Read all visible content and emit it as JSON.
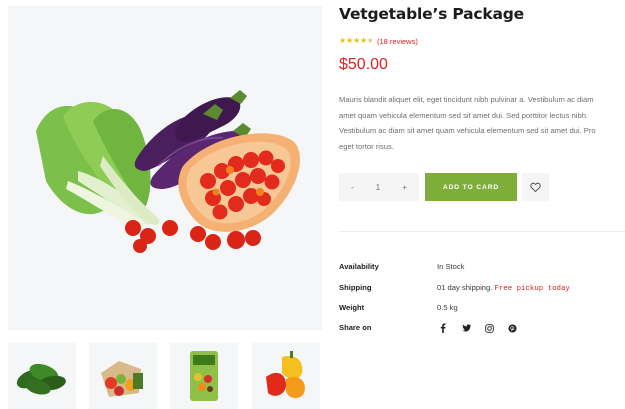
{
  "product": {
    "title": "Vetgetable’s Package",
    "rating": 4.5,
    "reviews": "(18 reviews)",
    "price": "$50.00",
    "description_lines": [
      "Mauris blandit aliquet elit, eget tincidunt nibh pulvinar a. Vestibulum ac diam",
      "amet quam vehicula elementum sed sit amet dui. Sed porttitor lectus nibh.",
      "Vestibulum ac diam sit amet quam vehicula elementum sed sit amet dui. Pro",
      "eget tortor risus."
    ]
  },
  "purchase": {
    "minus": "-",
    "quantity": "1",
    "plus": "+",
    "add_to_cart": "ADD TO CARD"
  },
  "meta": {
    "availability_label": "Availability",
    "availability_value": "In Stock",
    "shipping_label": "Shipping",
    "shipping_value": "01 day shipping.",
    "shipping_note": "Free pickup today",
    "weight_label": "Weight",
    "weight_value": "0.5 kg",
    "share_label": "Share on"
  },
  "gallery": {
    "main": "vegetable-package-image",
    "thumbnails": [
      "spinach-thumbnail",
      "grocery-bag-thumbnail",
      "fruit-veggie-pack-thumbnail",
      "bell-peppers-thumbnail"
    ]
  },
  "colors": {
    "accent_green": "#7fad39",
    "price_red": "#dd2222",
    "star_yellow": "#edbb0e"
  },
  "icons": {
    "wishlist": "heart-icon",
    "social": [
      "facebook-icon",
      "twitter-icon",
      "instagram-icon",
      "pinterest-icon"
    ]
  }
}
